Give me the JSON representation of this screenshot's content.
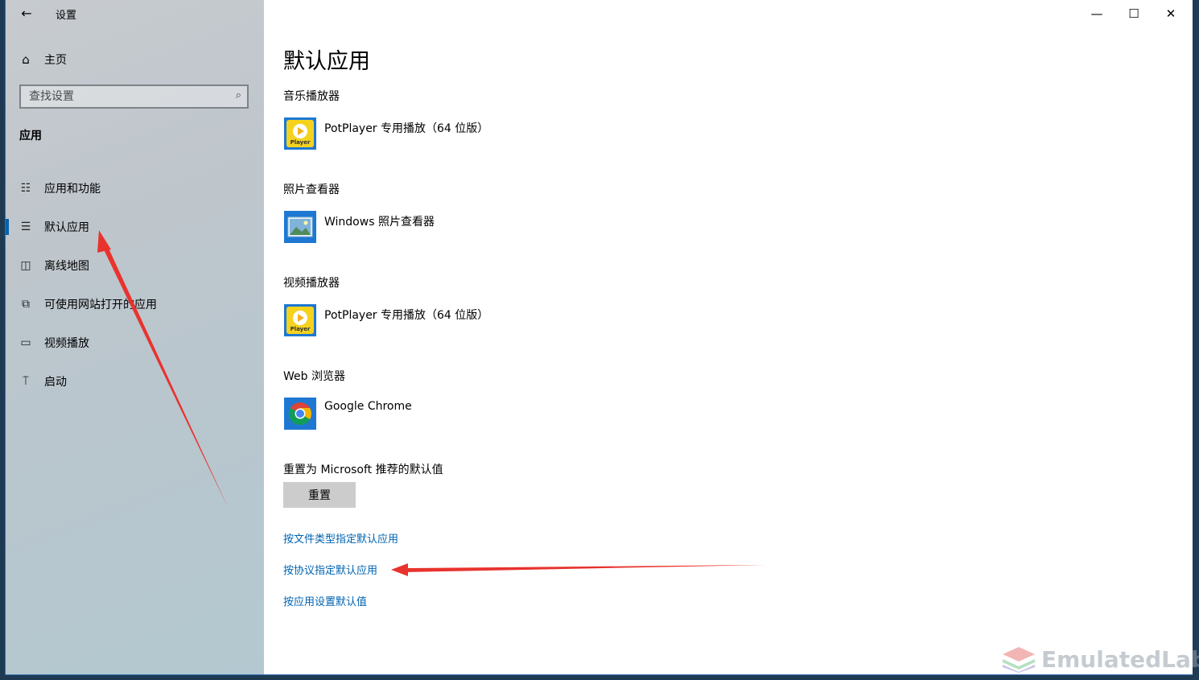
{
  "window": {
    "title": "设置"
  },
  "sidebar": {
    "home_label": "主页",
    "search_placeholder": "查找设置",
    "section_label": "应用",
    "items": [
      {
        "label": "应用和功能",
        "icon": "apps-list-icon"
      },
      {
        "label": "默认应用",
        "icon": "default-apps-icon",
        "active": true
      },
      {
        "label": "离线地图",
        "icon": "map-icon"
      },
      {
        "label": "可使用网站打开的应用",
        "icon": "open-website-icon"
      },
      {
        "label": "视频播放",
        "icon": "video-icon"
      },
      {
        "label": "启动",
        "icon": "startup-icon"
      }
    ]
  },
  "main": {
    "title": "默认应用",
    "categories": [
      {
        "label": "音乐播放器",
        "app": "PotPlayer 专用播放（64 位版）",
        "icon": "potplayer-icon"
      },
      {
        "label": "照片查看器",
        "app": "Windows 照片查看器",
        "icon": "photo-viewer-icon"
      },
      {
        "label": "视频播放器",
        "app": "PotPlayer 专用播放（64 位版）",
        "icon": "potplayer-icon"
      },
      {
        "label": "Web 浏览器",
        "app": "Google Chrome",
        "icon": "chrome-icon"
      }
    ],
    "reset_label": "重置为 Microsoft 推荐的默认值",
    "reset_button": "重置",
    "links": [
      "按文件类型指定默认应用",
      "按协议指定默认应用",
      "按应用设置默认值"
    ],
    "potplayer_icon_text": "Player"
  },
  "watermark": "EmulatedLab",
  "colors": {
    "accent": "#0063b1",
    "annotation": "#e8332e"
  }
}
